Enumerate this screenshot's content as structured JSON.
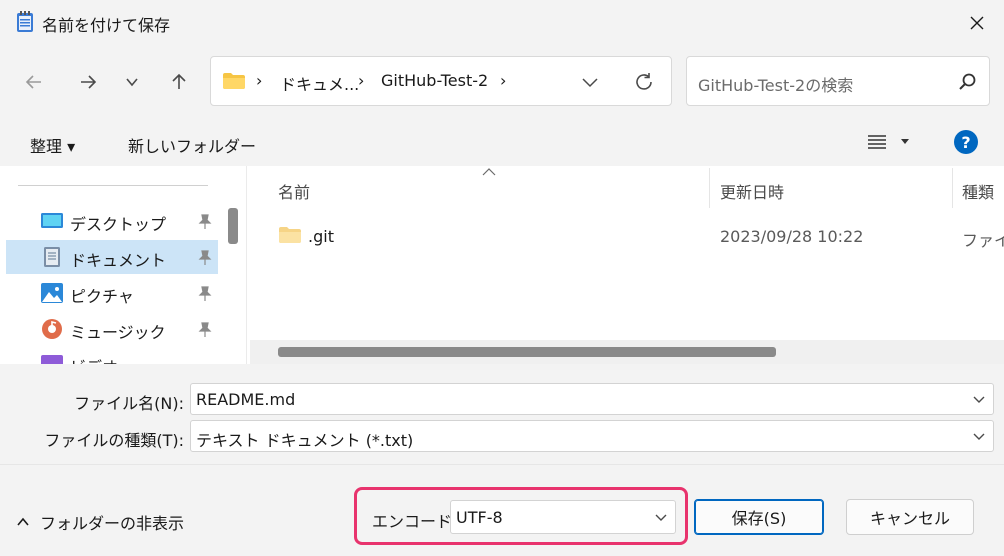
{
  "window": {
    "title": "名前を付けて保存"
  },
  "address": {
    "crumbs": [
      "ドキュメ...",
      "GitHub-Test-2"
    ]
  },
  "search": {
    "placeholder": "GitHub-Test-2の検索"
  },
  "commands": {
    "organize": "整理 ▾",
    "new_folder": "新しいフォルダー"
  },
  "sidebar": {
    "items": [
      {
        "label": "デスクトップ",
        "icon": "desktop-icon"
      },
      {
        "label": "ドキュメント",
        "icon": "documents-icon",
        "selected": true
      },
      {
        "label": "ピクチャ",
        "icon": "pictures-icon"
      },
      {
        "label": "ミュージック",
        "icon": "music-icon"
      },
      {
        "label": "ビデオ",
        "icon": "videos-icon"
      }
    ]
  },
  "columns": {
    "name": "名前",
    "modified": "更新日時",
    "type": "種類"
  },
  "files": [
    {
      "name": ".git",
      "modified": "2023/09/28 10:22",
      "type": "ファイル"
    }
  ],
  "form": {
    "filename_label": "ファイル名(N):",
    "filename_value": "README.md",
    "filetype_label": "ファイルの種類(T):",
    "filetype_value": "テキスト ドキュメント (*.txt)"
  },
  "footer": {
    "hide_folders": "フォルダーの非表示",
    "encoding_label": "エンコード:",
    "encoding_value": "UTF-8",
    "save": "保存(S)",
    "cancel": "キャンセル"
  },
  "colors": {
    "accent": "#0067c0",
    "highlight": "#e8336d",
    "selection": "#cce4f7"
  }
}
